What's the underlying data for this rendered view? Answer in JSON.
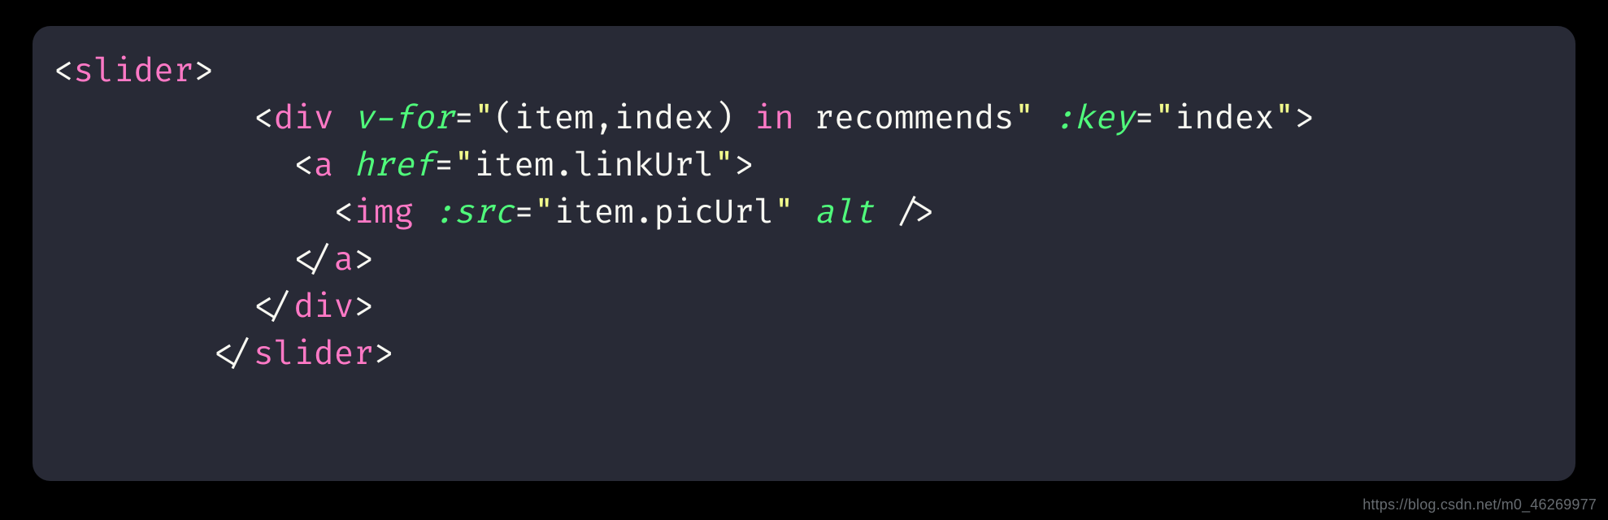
{
  "watermark": "https://blog.csdn.net/m0_46269977",
  "code": {
    "indent0": "",
    "indent1": "          ",
    "indent2": "            ",
    "indent3": "              ",
    "lt": "<",
    "gt": ">",
    "ltc": "</",
    "sgt": " />",
    "eq": "=",
    "q": "\"",
    "sp": " ",
    "tag_slider": "slider",
    "tag_div": "div",
    "tag_a": "a",
    "tag_img": "img",
    "attr_vfor": "v-for",
    "attr_key": ":key",
    "attr_href": "href",
    "attr_src": ":src",
    "attr_alt": "alt",
    "str_vfor_open": "(item,index) ",
    "str_vfor_in": "in",
    "str_vfor_rest": " recommends",
    "str_key": "index",
    "str_href": "item.linkUrl",
    "str_src": "item.picUrl"
  }
}
